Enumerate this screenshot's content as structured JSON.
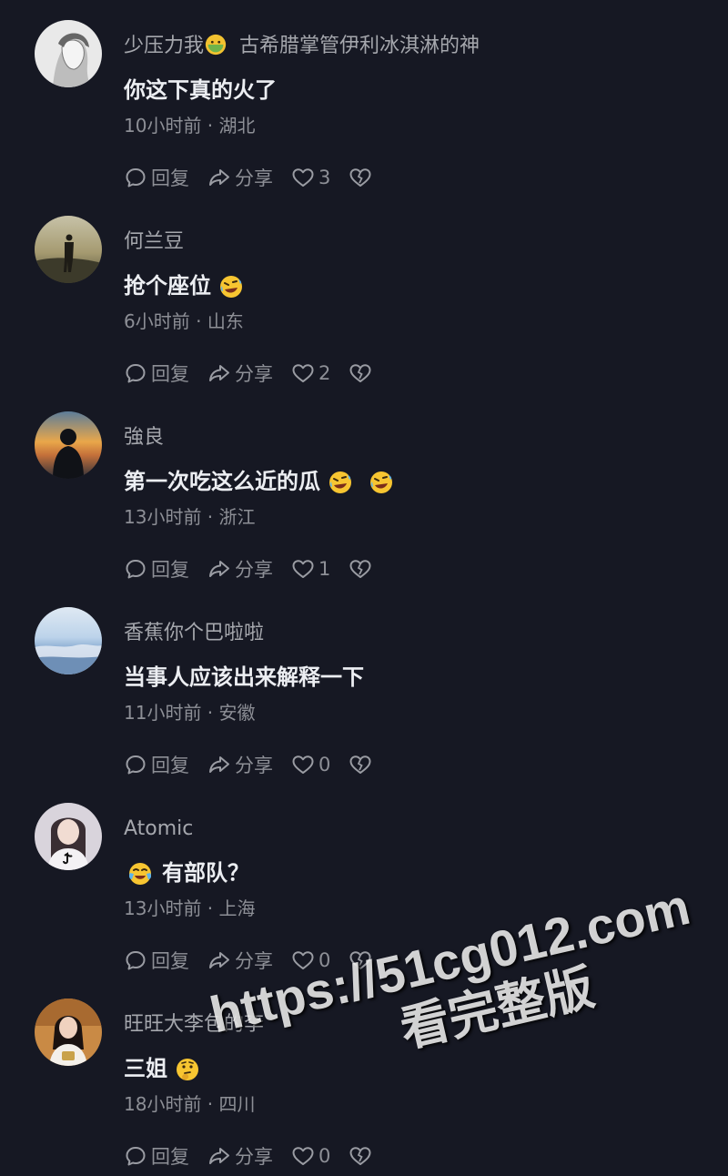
{
  "comments": [
    {
      "username": "少压力我",
      "username_suffix": "古希腊掌管伊利冰淇淋的神",
      "username_emoji": "sick-emoji",
      "text": "你这下真的火了",
      "text_emojis": [],
      "time": "10小时前",
      "location": "湖北",
      "reply_label": "回复",
      "share_label": "分享",
      "likes": "3"
    },
    {
      "username": "何兰豆",
      "username_suffix": "",
      "text": "抢个座位",
      "text_emojis": [
        "rofl-emoji"
      ],
      "time": "6小时前",
      "location": "山东",
      "reply_label": "回复",
      "share_label": "分享",
      "likes": "2"
    },
    {
      "username": "強良",
      "username_suffix": "",
      "text": "第一次吃这么近的瓜",
      "text_emojis": [
        "rofl-emoji",
        "rofl-emoji"
      ],
      "time": "13小时前",
      "location": "浙江",
      "reply_label": "回复",
      "share_label": "分享",
      "likes": "1"
    },
    {
      "username": "香蕉你个巴啦啦",
      "username_suffix": "",
      "text": "当事人应该出来解释一下",
      "text_emojis": [],
      "time": "11小时前",
      "location": "安徽",
      "reply_label": "回复",
      "share_label": "分享",
      "likes": "0"
    },
    {
      "username": "Atomic",
      "username_suffix": "",
      "text": "有部队？",
      "text_emojis_before": [
        "crying-laughing-emoji"
      ],
      "time": "13小时前",
      "location": "上海",
      "reply_label": "回复",
      "share_label": "分享",
      "likes": "0"
    },
    {
      "username": "旺旺大李包的李",
      "username_suffix": "",
      "text": "三姐",
      "text_emojis": [
        "thinking-emoji"
      ],
      "time": "18小时前",
      "location": "四川",
      "reply_label": "回复",
      "share_label": "分享",
      "likes": "0"
    }
  ],
  "watermark": {
    "url": "https://51cg012.com",
    "subtitle": "看完整版"
  },
  "colors": {
    "background": "#161823",
    "username": "#a5a7ad",
    "text": "#eceef2",
    "meta": "#8d8f96"
  }
}
